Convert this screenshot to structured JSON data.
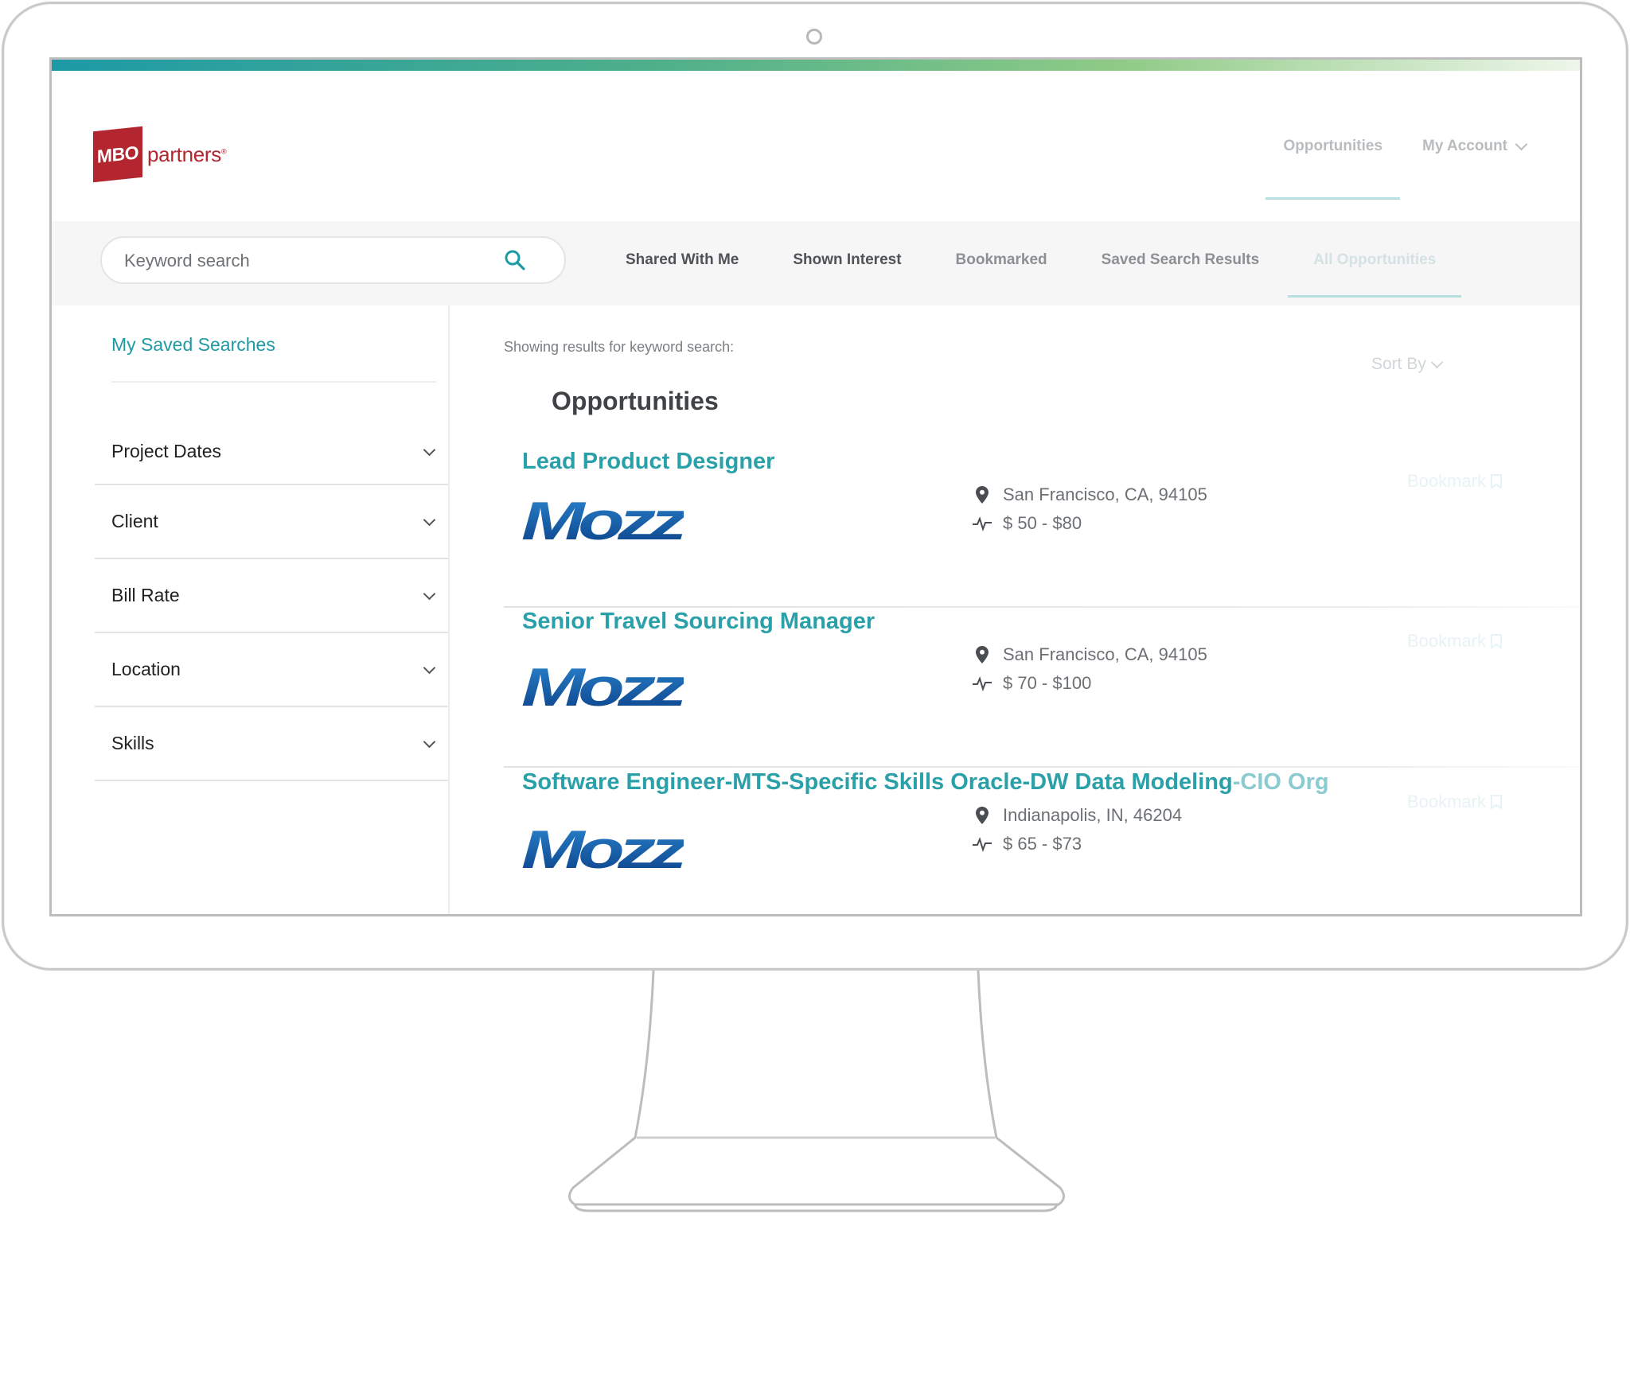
{
  "brand": {
    "logo_badge": "MBO",
    "logo_word": "partners",
    "color": "#b3262f"
  },
  "top_nav": {
    "opportunities": "Opportunities",
    "my_account": "My Account"
  },
  "search": {
    "placeholder": "Keyword search"
  },
  "tabs": [
    "Shared With Me",
    "Shown Interest",
    "Bookmarked",
    "Saved Search Results",
    "All Opportunities"
  ],
  "sidebar": {
    "saved_searches": "My Saved Searches",
    "filters": [
      "Project Dates",
      "Client",
      "Bill Rate",
      "Location",
      "Skills"
    ]
  },
  "main": {
    "results_note": "Showing results for keyword search:",
    "sort_by": "Sort By",
    "section_title": "Opportunities",
    "bookmark_label": "Bookmark",
    "jobs": [
      {
        "title": "Lead Product Designer",
        "company": "Mozz",
        "location": "San Francisco, CA, 94105",
        "rate": "$ 50 - $80"
      },
      {
        "title": "Senior Travel Sourcing Manager",
        "company": "Mozz",
        "location": "San Francisco, CA, 94105",
        "rate": "$ 70 - $100"
      },
      {
        "title_main": "Software Engineer-MTS-Specific Skills Oracle-DW Data Modeling",
        "title_fade": "-CIO Org",
        "company": "Mozz",
        "location": "Indianapolis, IN, 46204",
        "rate": "$ 65 - $73"
      }
    ]
  },
  "colors": {
    "accent": "#1e9aa4",
    "job_title": "#2aa0a9",
    "brand_red": "#b3262f"
  }
}
